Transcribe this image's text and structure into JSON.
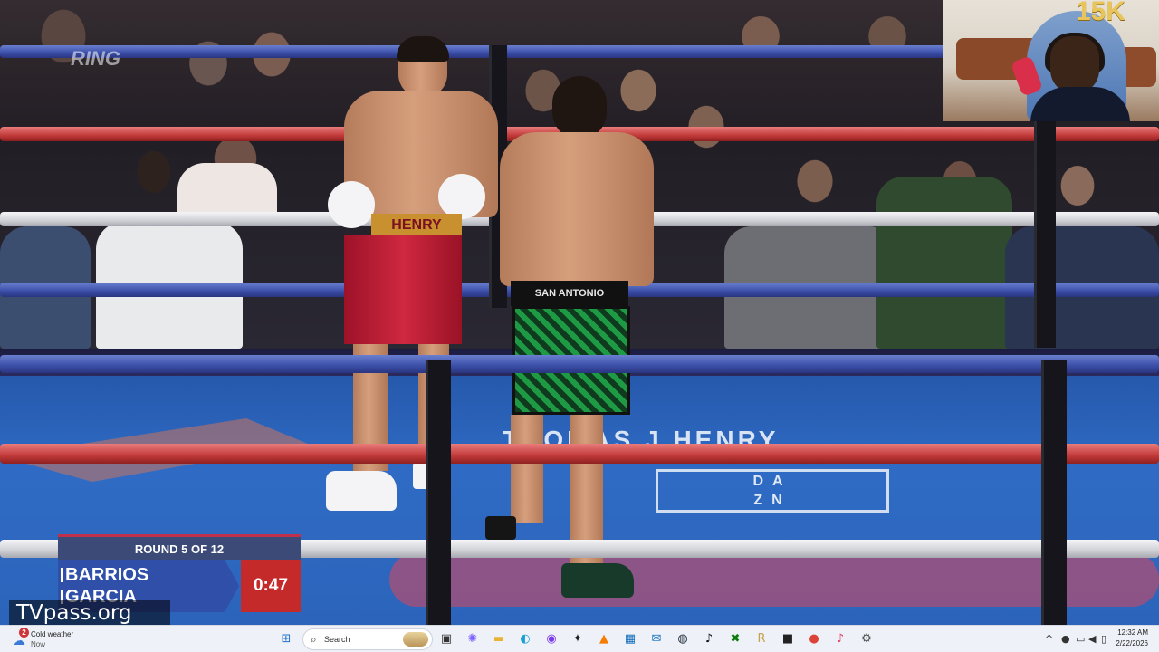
{
  "broadcast": {
    "network_logo": "RING",
    "canvas_name": "THOMAS J HENRY",
    "canvas_logo_top": "DA",
    "canvas_logo_bottom": "ZN",
    "trunks_left": "HENRY",
    "trunks_right": "SAN ANTONIO"
  },
  "scoreboard": {
    "round": "ROUND 5 OF 12",
    "fighter_1": "BARRIOS",
    "fighter_2": "GARCIA",
    "clock": "0:47",
    "colors": {
      "round_bar": "#3c4a78",
      "names_bg": "#2f4fa8",
      "clock_bg": "#c42a2a"
    }
  },
  "watermark": "TVpass.org",
  "webcam": {
    "sub_goal": "15K"
  },
  "taskbar": {
    "weather": {
      "title": "Cold weather",
      "subtitle": "Now",
      "badge": "2",
      "icon": "weather-icon"
    },
    "search": {
      "placeholder": "Search"
    },
    "apps": [
      {
        "name": "start-button",
        "glyph": "⊞",
        "color": "#1f6fd1"
      },
      {
        "name": "task-view-icon",
        "glyph": "▣",
        "color": "#333"
      },
      {
        "name": "copilot-icon",
        "glyph": "✺",
        "color": "#7b61ff"
      },
      {
        "name": "file-explorer-icon",
        "glyph": "▬",
        "color": "#e8b339"
      },
      {
        "name": "edge-icon",
        "glyph": "◐",
        "color": "#1b9fd6"
      },
      {
        "name": "messenger-icon",
        "glyph": "◉",
        "color": "#7c3aed"
      },
      {
        "name": "chatgpt-icon",
        "glyph": "✦",
        "color": "#222"
      },
      {
        "name": "avast-icon",
        "glyph": "▲",
        "color": "#f57c00"
      },
      {
        "name": "store-icon",
        "glyph": "▦",
        "color": "#0f6cbd"
      },
      {
        "name": "outlook-icon",
        "glyph": "✉",
        "color": "#0f6cbd"
      },
      {
        "name": "steam-icon",
        "glyph": "◍",
        "color": "#1b2838"
      },
      {
        "name": "tiktok-icon",
        "glyph": "♪",
        "color": "#111"
      },
      {
        "name": "xbox-icon",
        "glyph": "✖",
        "color": "#107c10"
      },
      {
        "name": "runescape-icon",
        "glyph": "R",
        "color": "#c8a24b"
      },
      {
        "name": "media-icon",
        "glyph": "■",
        "color": "#222"
      },
      {
        "name": "chrome-icon",
        "glyph": "●",
        "color": "#db4437"
      },
      {
        "name": "tiktok-studio-icon",
        "glyph": "♪",
        "color": "#e4405f"
      },
      {
        "name": "settings-icon",
        "glyph": "⚙",
        "color": "#555"
      }
    ],
    "tray": {
      "chevron": "^",
      "time": "12:32 AM",
      "date": "2/22/2026"
    }
  }
}
